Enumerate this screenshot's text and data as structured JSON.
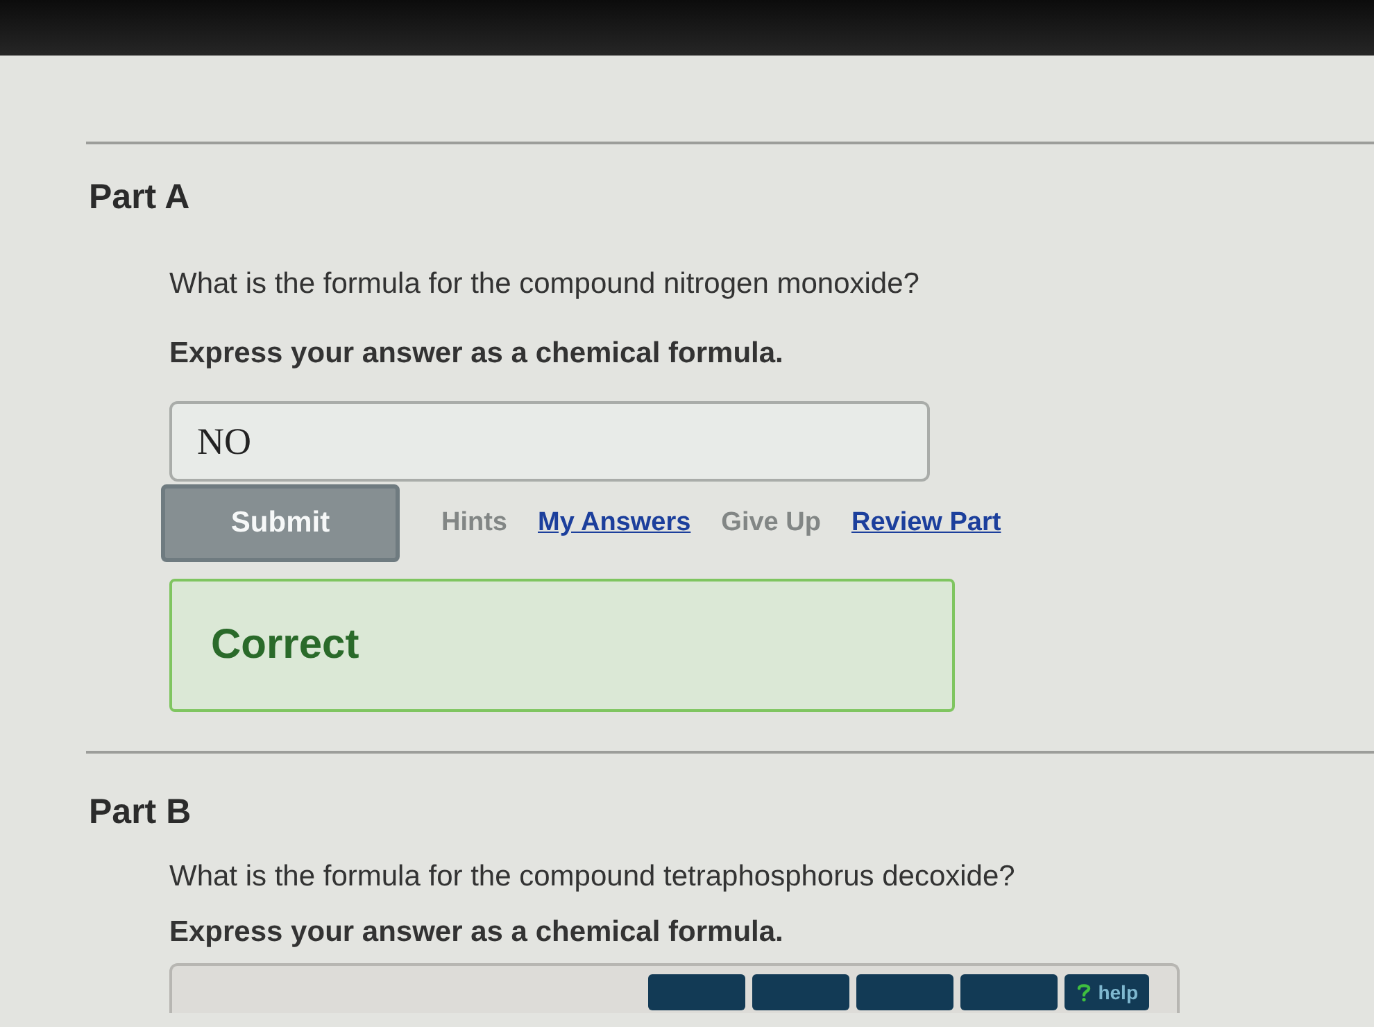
{
  "parts": [
    {
      "title": "Part A",
      "question": "What is the formula for the compound nitrogen monoxide?",
      "instruction": "Express your answer as a chemical formula.",
      "answer": {
        "value": "NO"
      },
      "actions": [
        {
          "kind": "button",
          "label": "Submit",
          "disabled": true
        },
        {
          "kind": "link",
          "label": "Hints",
          "disabled": true
        },
        {
          "kind": "link",
          "label": "My Answers",
          "disabled": false
        },
        {
          "kind": "link",
          "label": "Give Up",
          "disabled": true
        },
        {
          "kind": "link",
          "label": "Review Part",
          "disabled": false
        }
      ],
      "feedback": {
        "kind": "correct",
        "text": "Correct"
      }
    },
    {
      "title": "Part B",
      "question": "What is the formula for the compound tetraphosphorus decoxide?",
      "instruction": "Express your answer as a chemical formula.",
      "answer": {
        "toolbar": [
          {
            "kind": "tool"
          },
          {
            "kind": "tool"
          },
          {
            "kind": "tool"
          },
          {
            "kind": "tool"
          },
          {
            "kind": "help",
            "label": "help"
          }
        ]
      }
    }
  ]
}
